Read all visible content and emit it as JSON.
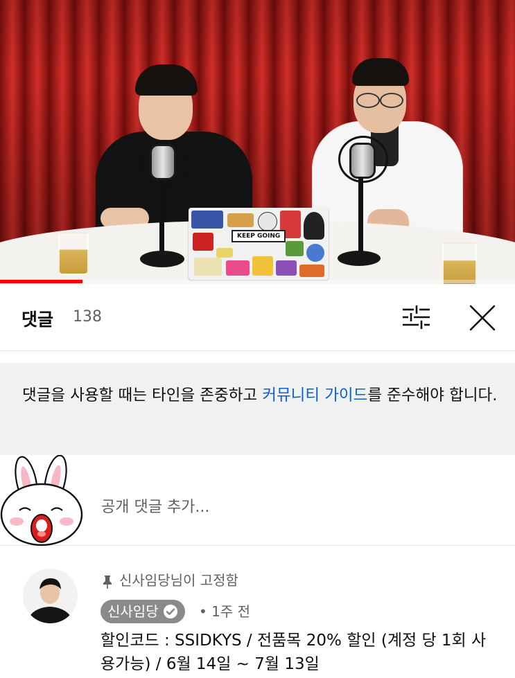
{
  "video": {
    "laptop_sticker_text": "KEEP GOING",
    "progress_fraction": 0.16
  },
  "comments_header": {
    "title": "댓글",
    "count": "138",
    "filter_icon": "tune-icon",
    "close_icon": "close-icon"
  },
  "guideline": {
    "text_before": "댓글을 사용할 때는 타인을 존중하고 ",
    "link": "커뮤니티 가이드",
    "text_after": "를 준수해야 합니다."
  },
  "add_comment": {
    "placeholder": "공개 댓글 추가..."
  },
  "pinned_comment": {
    "pinned_label": "신사임당님이 고정함",
    "author": "신사임당",
    "time": "• 1주 전",
    "body": "할인코드 : SSIDKYS / 전품목 20% 할인 (계정 당 1회 사용가능) / 6월 14일 ~ 7월 13일"
  },
  "colors": {
    "accent_link": "#065fd4",
    "progress": "#ff0000",
    "author_chip": "#8a8a8a"
  }
}
